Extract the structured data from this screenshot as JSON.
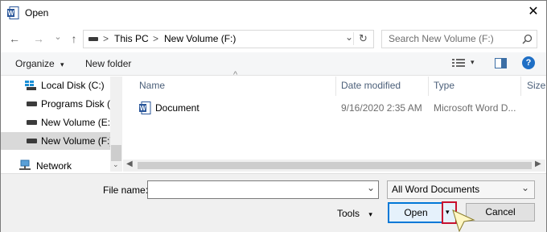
{
  "window": {
    "title": "Open",
    "close_glyph": "✕"
  },
  "nav": {
    "back_glyph": "←",
    "forward_glyph": "→",
    "recent_glyph": "⌄",
    "up_glyph": "↑",
    "path": [
      "This PC",
      "New Volume (F:)"
    ],
    "sep": ">",
    "refresh_glyph": "↻",
    "dropdown_glyph": "⌄",
    "search_placeholder": "Search New Volume (F:)"
  },
  "toolbar": {
    "organize": "Organize",
    "new_folder": "New folder",
    "help": "?"
  },
  "sidebar": {
    "items": [
      {
        "label": "Local Disk (C:)",
        "selected": false
      },
      {
        "label": "Programs Disk (D",
        "selected": false
      },
      {
        "label": "New Volume (E:)",
        "selected": false
      },
      {
        "label": "New Volume (F:)",
        "selected": true
      },
      {
        "label": "Network",
        "selected": false
      }
    ]
  },
  "columns": {
    "name": "Name",
    "date": "Date modified",
    "type": "Type",
    "size": "Size",
    "sort_glyph": "^"
  },
  "files": [
    {
      "name": "Document",
      "date": "9/16/2020 2:35 AM",
      "type": "Microsoft Word D..."
    }
  ],
  "bottom": {
    "file_name_label": "File name:",
    "file_name_value": "",
    "filter_value": "All Word Documents",
    "tools": "Tools",
    "open": "Open",
    "cancel": "Cancel",
    "caret": "▾"
  },
  "colors": {
    "accent": "#0078d7",
    "highlight": "#c8102e",
    "word_blue": "#2b579a"
  }
}
